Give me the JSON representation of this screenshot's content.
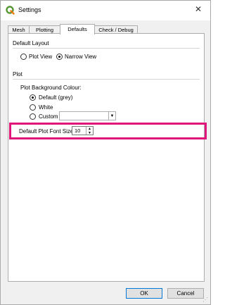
{
  "window": {
    "title": "Settings",
    "close_glyph": "✕"
  },
  "tabs": [
    {
      "label": "Mesh",
      "active": false
    },
    {
      "label": "Plotting",
      "active": false
    },
    {
      "label": "Defaults",
      "active": true
    },
    {
      "label": "Check / Debug",
      "active": false
    }
  ],
  "default_layout": {
    "heading": "Default Layout",
    "options": [
      {
        "label": "Plot View",
        "selected": false
      },
      {
        "label": "Narrow View",
        "selected": true
      }
    ]
  },
  "plot": {
    "heading": "Plot",
    "background_label": "Plot Background Colour:",
    "background_options": [
      {
        "label": "Default (grey)",
        "selected": true
      },
      {
        "label": "White",
        "selected": false
      },
      {
        "label": "Custom",
        "selected": false
      }
    ],
    "custom_colour_value": "",
    "font_size_label": "Default Plot Font Size",
    "font_size_value": "10"
  },
  "buttons": {
    "ok": "OK",
    "cancel": "Cancel"
  },
  "colors": {
    "highlight": "#e0167a",
    "qgis_green": "#589632"
  },
  "icons": {
    "app": "qgis-logo-icon",
    "close": "close-icon",
    "dropdown": "chevron-down-icon",
    "spin": "spin-arrows-icon",
    "resize": "resize-grip-icon"
  }
}
